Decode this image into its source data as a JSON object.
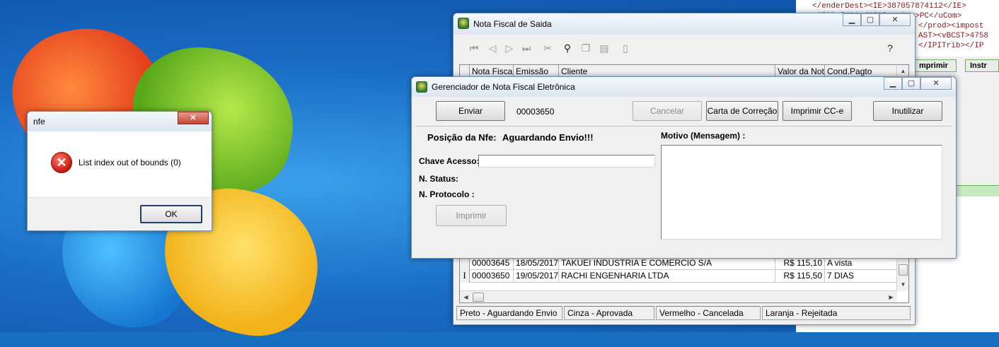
{
  "xml_editor": {
    "lines": [
      "</enderDest><IE>387057874112</IE>",
      "<CFOP>5401</CFOP><uCom>PC</uCom>",
      "</prod><impost",
      "AST><vBCST>4758",
      "</IPITrib></IP"
    ],
    "btn_imprimir": "mprimir",
    "btn_instr": "Instr"
  },
  "nota_fiscal_saida": {
    "title": "Nota Fiscal de Saida",
    "columns": [
      "Nota Fiscal",
      "Emissão",
      "Cliente",
      "Valor da Nota",
      "Cond.Pagto"
    ],
    "rows": [
      {
        "nota": "00003645",
        "emissao": "18/05/2017",
        "cliente": "TAKUEI INDUSTRIA E COMERCIO S/A",
        "valor": "R$ 115,10",
        "cond": "A vista"
      },
      {
        "nota": "00003650",
        "emissao": "19/05/2017",
        "cliente": "RACHI ENGENHARIA LTDA",
        "valor": "R$ 115,50",
        "cond": "7 DIAS"
      }
    ],
    "status": [
      "Preto - Aguardando Envio",
      "Cinza - Aprovada",
      "Vermelho - Cancelada",
      "Laranja - Rejeitada"
    ]
  },
  "gerenciador": {
    "title": "Gerenciador de Nota Fiscal Eletrônica",
    "btn_enviar": "Enviar",
    "nota_numero": "00003650",
    "btn_cancelar": "Cancelar",
    "btn_carta": "Carta de Correção",
    "btn_imprimir_cce": "Imprimir CC-e",
    "btn_inutilizar": "Inutilizar",
    "posicao_label": "Posição da Nfe:",
    "posicao_value": "Aguardando Envio!!!",
    "chave_label": "Chave Acesso:",
    "chave_value": "",
    "status_label": "N. Status:",
    "protocolo_label": "N. Protocolo :",
    "btn_imprimir": "Imprimir",
    "motivo_label": "Motivo (Mensagem) :",
    "motivo_value": ""
  },
  "message_box": {
    "title": "nfe",
    "message": "List index out of bounds (0)",
    "ok_label": "OK"
  }
}
